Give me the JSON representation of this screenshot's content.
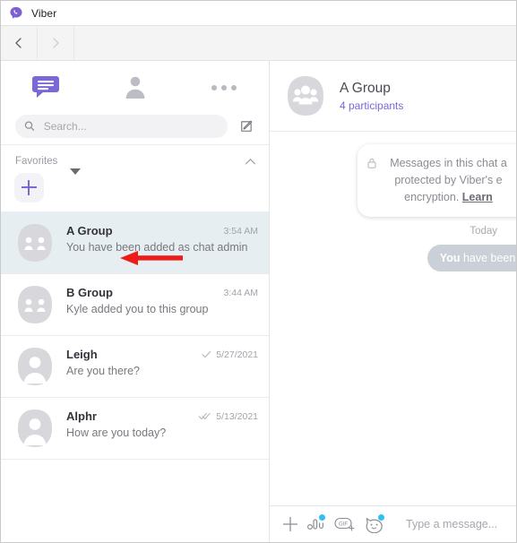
{
  "window": {
    "title": "Viber",
    "logo_icon": "viber-logo-icon"
  },
  "navbar": {
    "back_icon": "chevron-left-icon",
    "forward_icon": "chevron-right-icon"
  },
  "sidebar": {
    "tabs": [
      {
        "name": "chats-tab",
        "icon": "chat-bubble-icon",
        "active": true
      },
      {
        "name": "contacts-tab",
        "icon": "person-icon",
        "active": false
      },
      {
        "name": "more-tab",
        "icon": "more-dots-icon",
        "active": false
      }
    ],
    "search": {
      "placeholder": "Search...",
      "value": "",
      "icon": "search-icon"
    },
    "compose_icon": "compose-new-message-icon",
    "favorites": {
      "label": "Favorites",
      "collapse_icon": "chevron-up-icon",
      "add_icon": "plus-icon"
    },
    "chats": [
      {
        "name": "A Group",
        "preview": "You have been added as chat admin",
        "time": "3:54 AM",
        "avatar": "group-avatar",
        "selected": true,
        "status": ""
      },
      {
        "name": "B Group",
        "preview": "Kyle added you to this group",
        "time": "3:44 AM",
        "avatar": "group-avatar",
        "selected": false,
        "status": ""
      },
      {
        "name": "Leigh",
        "preview": "Are you there?",
        "time": "5/27/2021",
        "avatar": "person-avatar",
        "selected": false,
        "status": "sent-check"
      },
      {
        "name": "Alphr",
        "preview": "How are you today?",
        "time": "5/13/2021",
        "avatar": "person-avatar",
        "selected": false,
        "status": "delivered-double-check"
      }
    ]
  },
  "chat": {
    "header": {
      "title": "A Group",
      "participants": "4 participants",
      "avatar": "group-avatar-large"
    },
    "encryption_notice": {
      "lock_icon": "lock-icon",
      "line1": "Messages in this chat a",
      "line2": "protected by Viber's e",
      "line3_prefix": "encryption. ",
      "link": "Learn"
    },
    "day_separator": "Today",
    "messages": [
      {
        "sender_label": "You",
        "text": " have been added a",
        "align": "right"
      }
    ]
  },
  "composer": {
    "placeholder": "Type a message...",
    "value": "",
    "icons": [
      {
        "name": "add-attachment-icon",
        "badge": false
      },
      {
        "name": "sticker-icon",
        "badge": true
      },
      {
        "name": "gif-icon",
        "badge": false
      },
      {
        "name": "emoji-cat-icon",
        "badge": true
      }
    ]
  },
  "annotation": {
    "arrow_color": "#ee1b1b",
    "arrow_name": "red-pointer-arrow"
  },
  "colors": {
    "brand_purple": "#7b68d6",
    "selected_row": "#e7eef1",
    "bubble_gray": "#c9d0d8",
    "accent_blue": "#2ec1f0"
  }
}
